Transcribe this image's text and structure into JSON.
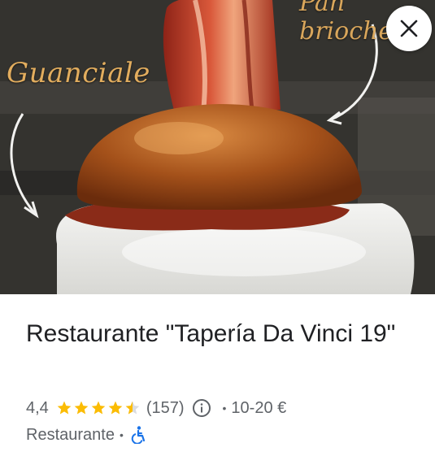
{
  "hero": {
    "script_left": "Guanciale",
    "script_right": "Pan brioche"
  },
  "place": {
    "title": "Restaurante \"Tapería Da Vinci 19\"",
    "rating": "4,4",
    "rating_value": 4.4,
    "reviews": "(157)",
    "price": "10-20 €",
    "category": "Restaurante"
  },
  "colors": {
    "star": "#fbbc04",
    "star_empty": "#dadce0",
    "accessible": "#1a73e8",
    "text_primary": "#202124",
    "text_secondary": "#5f6368"
  },
  "icons": {
    "close": "close-icon",
    "info": "info-icon",
    "wheelchair": "wheelchair-icon"
  }
}
